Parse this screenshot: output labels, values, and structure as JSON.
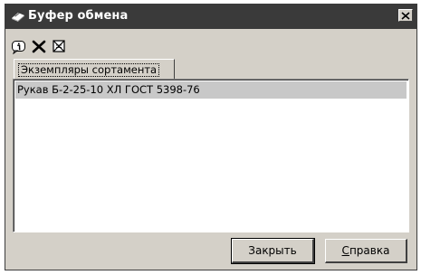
{
  "window": {
    "title": "Буфер обмена",
    "title_icon": "clipboard-app-icon",
    "close_icon": "close-icon"
  },
  "toolbar": {
    "items": [
      {
        "icon": "info-icon",
        "label": ""
      },
      {
        "icon": "delete-icon",
        "label": ""
      },
      {
        "icon": "clear-all-icon",
        "label": ""
      }
    ]
  },
  "tabs": [
    {
      "label": "Экземпляры сортамента",
      "selected": true
    }
  ],
  "list": {
    "items": [
      {
        "text": "Рукав Б-2-25-10 ХЛ ГОСТ 5398-76",
        "selected": true
      }
    ]
  },
  "buttons": {
    "close": "Закрыть",
    "help_first": "С",
    "help_rest": "правка"
  },
  "colors": {
    "titlebar": "#3a3a3a",
    "face": "#d4d0c8",
    "selection": "#c8c8c8"
  }
}
